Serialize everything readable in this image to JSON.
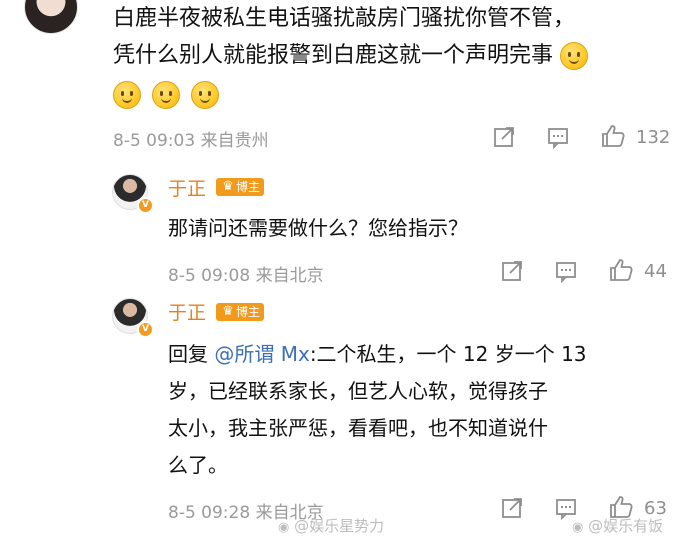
{
  "post": {
    "lines": [
      "白鹿半夜被私生电话骚扰敲房门骚扰你管不管，",
      "凭什么别人就能报警到白鹿这就一个声明完事"
    ],
    "meta": "8-5 09:03  来自贵州",
    "like_count": "132"
  },
  "replies": [
    {
      "username": "于正",
      "badge": "博主",
      "text": "那请问还需要做什么？您给指示？",
      "meta": "8-5 09:08  来自北京",
      "like_count": "44"
    },
    {
      "username": "于正",
      "badge": "博主",
      "reply_prefix": "回复",
      "mention": "@所谓 Mx",
      "lines": [
        ":二个私生，一个 12 岁一个 13",
        "岁，已经联系家长，但艺人心软，觉得孩子",
        "太小，我主张严惩，看看吧，也不知道说什",
        "么了。"
      ],
      "meta": "8-5 09:28  来自北京",
      "like_count": "63"
    }
  ],
  "watermarks": [
    "@娱乐星势力",
    "@娱乐有饭"
  ],
  "icons": [
    "share-icon",
    "comment-icon",
    "like-icon",
    "verified-v-icon",
    "crown-icon",
    "smile-emoji-icon",
    "weibo-logo-icon"
  ]
}
